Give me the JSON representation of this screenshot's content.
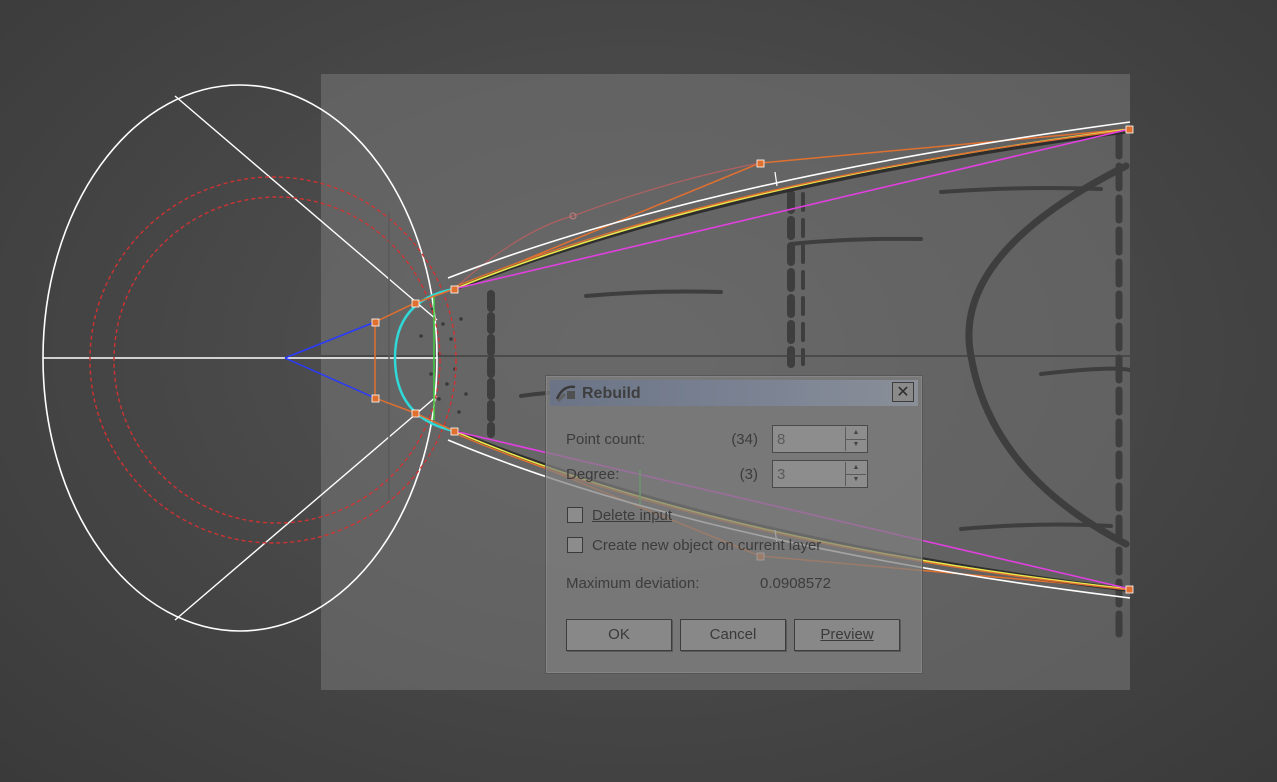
{
  "dialog": {
    "title": "Rebuild",
    "close_glyph": "✕",
    "title_icon": "rebuild-icon",
    "point_count": {
      "label": "Point count:",
      "original": "(34)",
      "value": "8"
    },
    "degree": {
      "label": "Degree:",
      "original": "(3)",
      "value": "3"
    },
    "delete_input": {
      "label": "Delete input",
      "checked": false
    },
    "create_new": {
      "label": "Create new object on current layer",
      "checked": false
    },
    "max_dev": {
      "label": "Maximum deviation:",
      "value": "0.0908572"
    },
    "buttons": {
      "ok": "OK",
      "cancel": "Cancel",
      "preview": "Preview"
    }
  },
  "colors": {
    "outline": "#ffffff",
    "circle": "#d03232",
    "magenta": "#e040e0",
    "orange": "#e07030",
    "yellow": "#e8e850",
    "cyan": "#30d8d8",
    "blue": "#2a3aff",
    "green": "#40d040"
  }
}
